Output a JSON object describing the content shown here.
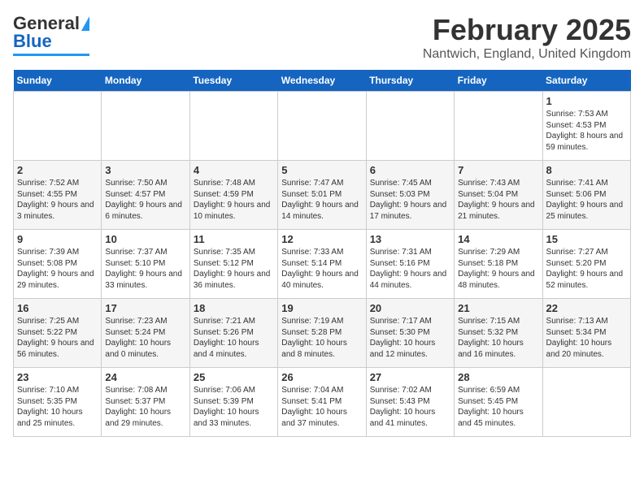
{
  "header": {
    "logo_general": "General",
    "logo_blue": "Blue",
    "title": "February 2025",
    "subtitle": "Nantwich, England, United Kingdom"
  },
  "days_of_week": [
    "Sunday",
    "Monday",
    "Tuesday",
    "Wednesday",
    "Thursday",
    "Friday",
    "Saturday"
  ],
  "weeks": [
    [
      {
        "day": "",
        "info": ""
      },
      {
        "day": "",
        "info": ""
      },
      {
        "day": "",
        "info": ""
      },
      {
        "day": "",
        "info": ""
      },
      {
        "day": "",
        "info": ""
      },
      {
        "day": "",
        "info": ""
      },
      {
        "day": "1",
        "info": "Sunrise: 7:53 AM\nSunset: 4:53 PM\nDaylight: 8 hours and 59 minutes."
      }
    ],
    [
      {
        "day": "2",
        "info": "Sunrise: 7:52 AM\nSunset: 4:55 PM\nDaylight: 9 hours and 3 minutes."
      },
      {
        "day": "3",
        "info": "Sunrise: 7:50 AM\nSunset: 4:57 PM\nDaylight: 9 hours and 6 minutes."
      },
      {
        "day": "4",
        "info": "Sunrise: 7:48 AM\nSunset: 4:59 PM\nDaylight: 9 hours and 10 minutes."
      },
      {
        "day": "5",
        "info": "Sunrise: 7:47 AM\nSunset: 5:01 PM\nDaylight: 9 hours and 14 minutes."
      },
      {
        "day": "6",
        "info": "Sunrise: 7:45 AM\nSunset: 5:03 PM\nDaylight: 9 hours and 17 minutes."
      },
      {
        "day": "7",
        "info": "Sunrise: 7:43 AM\nSunset: 5:04 PM\nDaylight: 9 hours and 21 minutes."
      },
      {
        "day": "8",
        "info": "Sunrise: 7:41 AM\nSunset: 5:06 PM\nDaylight: 9 hours and 25 minutes."
      }
    ],
    [
      {
        "day": "9",
        "info": "Sunrise: 7:39 AM\nSunset: 5:08 PM\nDaylight: 9 hours and 29 minutes."
      },
      {
        "day": "10",
        "info": "Sunrise: 7:37 AM\nSunset: 5:10 PM\nDaylight: 9 hours and 33 minutes."
      },
      {
        "day": "11",
        "info": "Sunrise: 7:35 AM\nSunset: 5:12 PM\nDaylight: 9 hours and 36 minutes."
      },
      {
        "day": "12",
        "info": "Sunrise: 7:33 AM\nSunset: 5:14 PM\nDaylight: 9 hours and 40 minutes."
      },
      {
        "day": "13",
        "info": "Sunrise: 7:31 AM\nSunset: 5:16 PM\nDaylight: 9 hours and 44 minutes."
      },
      {
        "day": "14",
        "info": "Sunrise: 7:29 AM\nSunset: 5:18 PM\nDaylight: 9 hours and 48 minutes."
      },
      {
        "day": "15",
        "info": "Sunrise: 7:27 AM\nSunset: 5:20 PM\nDaylight: 9 hours and 52 minutes."
      }
    ],
    [
      {
        "day": "16",
        "info": "Sunrise: 7:25 AM\nSunset: 5:22 PM\nDaylight: 9 hours and 56 minutes."
      },
      {
        "day": "17",
        "info": "Sunrise: 7:23 AM\nSunset: 5:24 PM\nDaylight: 10 hours and 0 minutes."
      },
      {
        "day": "18",
        "info": "Sunrise: 7:21 AM\nSunset: 5:26 PM\nDaylight: 10 hours and 4 minutes."
      },
      {
        "day": "19",
        "info": "Sunrise: 7:19 AM\nSunset: 5:28 PM\nDaylight: 10 hours and 8 minutes."
      },
      {
        "day": "20",
        "info": "Sunrise: 7:17 AM\nSunset: 5:30 PM\nDaylight: 10 hours and 12 minutes."
      },
      {
        "day": "21",
        "info": "Sunrise: 7:15 AM\nSunset: 5:32 PM\nDaylight: 10 hours and 16 minutes."
      },
      {
        "day": "22",
        "info": "Sunrise: 7:13 AM\nSunset: 5:34 PM\nDaylight: 10 hours and 20 minutes."
      }
    ],
    [
      {
        "day": "23",
        "info": "Sunrise: 7:10 AM\nSunset: 5:35 PM\nDaylight: 10 hours and 25 minutes."
      },
      {
        "day": "24",
        "info": "Sunrise: 7:08 AM\nSunset: 5:37 PM\nDaylight: 10 hours and 29 minutes."
      },
      {
        "day": "25",
        "info": "Sunrise: 7:06 AM\nSunset: 5:39 PM\nDaylight: 10 hours and 33 minutes."
      },
      {
        "day": "26",
        "info": "Sunrise: 7:04 AM\nSunset: 5:41 PM\nDaylight: 10 hours and 37 minutes."
      },
      {
        "day": "27",
        "info": "Sunrise: 7:02 AM\nSunset: 5:43 PM\nDaylight: 10 hours and 41 minutes."
      },
      {
        "day": "28",
        "info": "Sunrise: 6:59 AM\nSunset: 5:45 PM\nDaylight: 10 hours and 45 minutes."
      },
      {
        "day": "",
        "info": ""
      }
    ]
  ]
}
